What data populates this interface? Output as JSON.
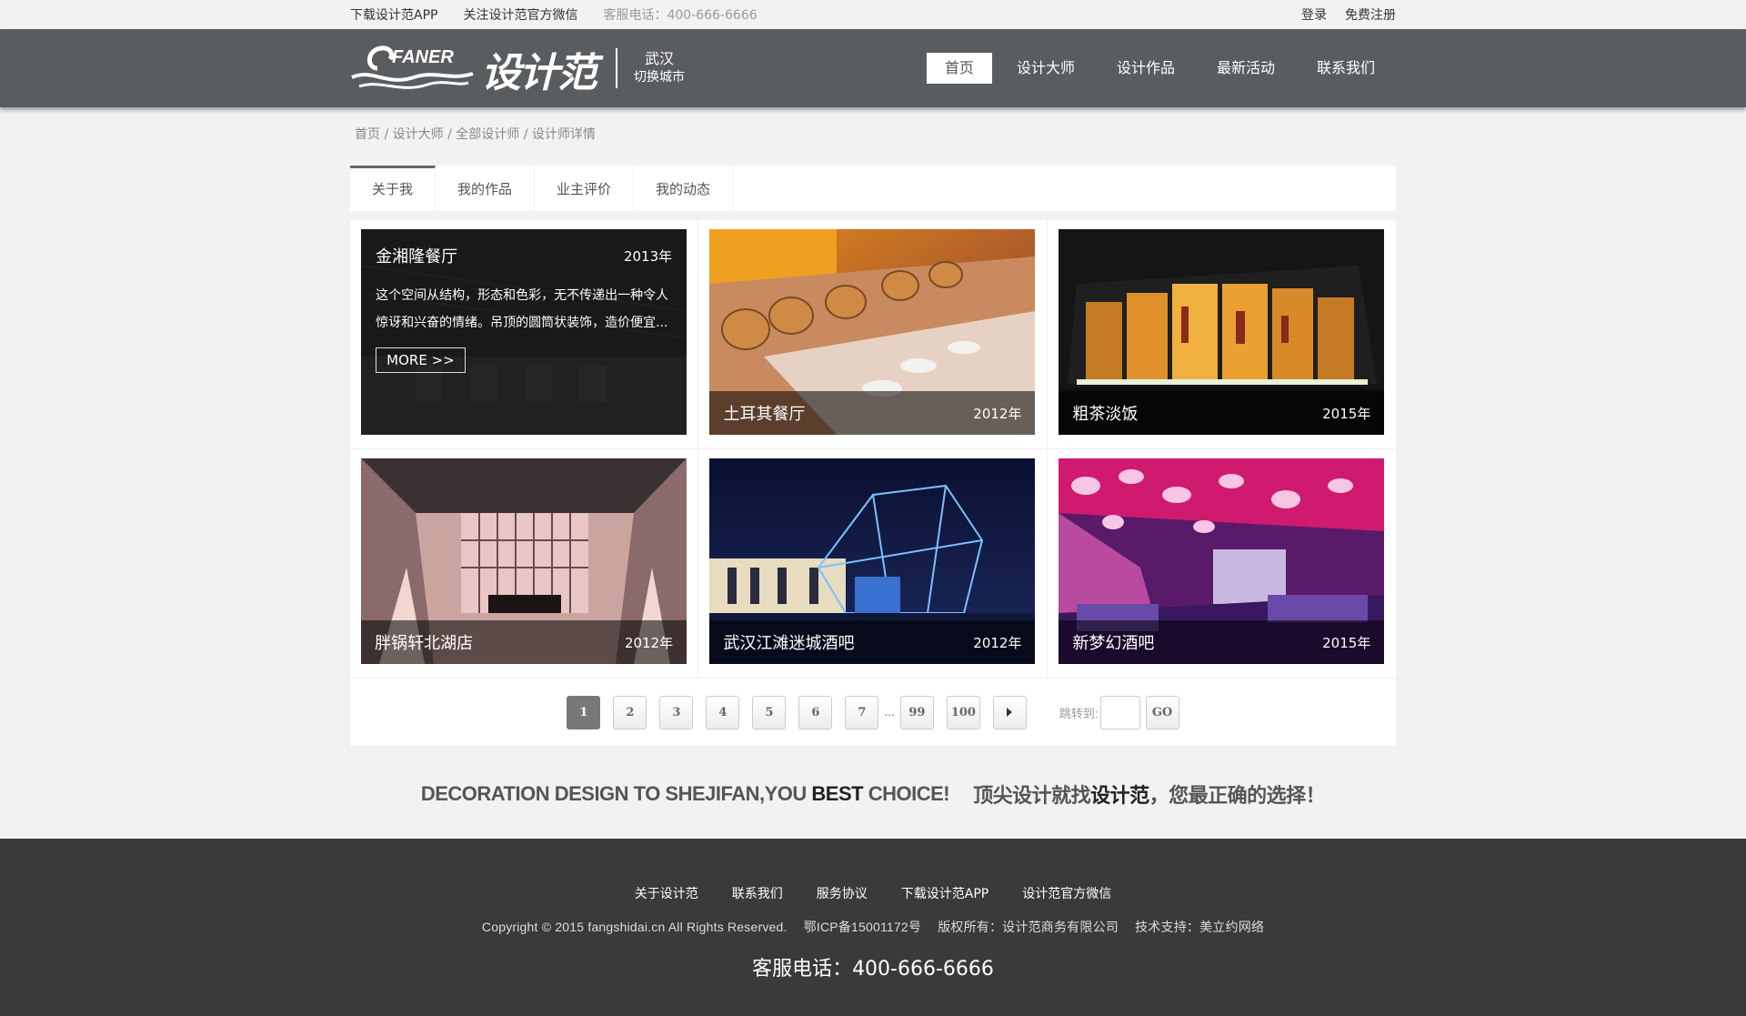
{
  "topbar": {
    "download_app": "下载设计范APP",
    "follow_wechat": "关注设计范官方微信",
    "service_tel": "客服电话：400-666-6666",
    "login": "登录",
    "register": "免费注册"
  },
  "header": {
    "logo_en": "FANER",
    "logo_cn": "设计范",
    "city": "武汉",
    "switch_city": "切换城市",
    "nav": [
      "首页",
      "设计大师",
      "设计作品",
      "最新活动",
      "联系我们"
    ]
  },
  "breadcrumb": [
    "首页",
    "设计大师",
    "全部设计师",
    "设计师详情"
  ],
  "tabs": [
    "关于我",
    "我的作品",
    "业主评价",
    "我的动态"
  ],
  "featured": {
    "title": "金湘隆餐厅",
    "year": "2013年",
    "description": "这个空间从结构，形态和色彩，无不传递出一种令人惊讶和兴奋的情绪。吊顶的圆筒状装饰，造价便宜...",
    "more": "MORE >>"
  },
  "works": [
    {
      "title": "土耳其餐厅",
      "year": "2012年"
    },
    {
      "title": "粗茶淡饭",
      "year": "2015年"
    },
    {
      "title": "胖锅轩北湖店",
      "year": "2012年"
    },
    {
      "title": "武汉江滩迷城酒吧",
      "year": "2012年"
    },
    {
      "title": "新梦幻酒吧",
      "year": "2015年"
    }
  ],
  "pager": {
    "pages": [
      "1",
      "2",
      "3",
      "4",
      "5",
      "6",
      "7"
    ],
    "ellipsis": "...",
    "tail_pages": [
      "99",
      "100"
    ],
    "jump_label": "跳转到:",
    "go": "GO"
  },
  "slogan": {
    "en_prefix": "DECORATION DESIGN TO SHEJIFAN,YOU ",
    "en_bold": "BEST",
    "en_suffix": " CHOICE!",
    "cn_prefix": "顶尖设计就找",
    "cn_bold": "设计范",
    "cn_suffix": "，您最正确的选择！"
  },
  "footer": {
    "links": [
      "关于设计范",
      "联系我们",
      "服务协议",
      "下载设计范APP",
      "设计范官方微信"
    ],
    "copyright": "Copyright © 2015 fangshidai.cn All Rights Reserved.",
    "icp": "鄂ICP备15001172号",
    "owner": "版权所有：设计范商务有限公司",
    "support": "技术支持：美立约网络",
    "tel": "客服电话：400-666-6666"
  }
}
